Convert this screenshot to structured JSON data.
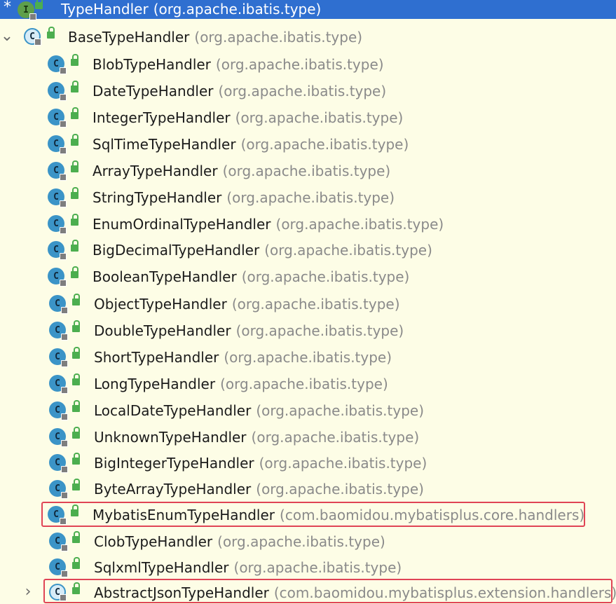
{
  "root": {
    "name": "TypeHandler",
    "package": "(org.apache.ibatis.type)",
    "star": "*",
    "icon_letter": "I"
  },
  "base": {
    "name": "BaseTypeHandler",
    "package": "(org.apache.ibatis.type)",
    "icon_letter": "C"
  },
  "items": [
    {
      "name": "BlobTypeHandler",
      "package": "(org.apache.ibatis.type)"
    },
    {
      "name": "DateTypeHandler",
      "package": "(org.apache.ibatis.type)"
    },
    {
      "name": "IntegerTypeHandler",
      "package": "(org.apache.ibatis.type)"
    },
    {
      "name": "SqlTimeTypeHandler",
      "package": "(org.apache.ibatis.type)"
    },
    {
      "name": "ArrayTypeHandler",
      "package": "(org.apache.ibatis.type)"
    },
    {
      "name": "StringTypeHandler",
      "package": "(org.apache.ibatis.type)"
    },
    {
      "name": "EnumOrdinalTypeHandler",
      "package": "(org.apache.ibatis.type)"
    },
    {
      "name": "BigDecimalTypeHandler",
      "package": "(org.apache.ibatis.type)"
    },
    {
      "name": "BooleanTypeHandler",
      "package": "(org.apache.ibatis.type)"
    },
    {
      "name": "ObjectTypeHandler",
      "package": "(org.apache.ibatis.type)"
    },
    {
      "name": "DoubleTypeHandler",
      "package": "(org.apache.ibatis.type)"
    },
    {
      "name": "ShortTypeHandler",
      "package": "(org.apache.ibatis.type)"
    },
    {
      "name": "LongTypeHandler",
      "package": "(org.apache.ibatis.type)"
    },
    {
      "name": "LocalDateTypeHandler",
      "package": "(org.apache.ibatis.type)"
    },
    {
      "name": "UnknownTypeHandler",
      "package": "(org.apache.ibatis.type)"
    },
    {
      "name": "BigIntegerTypeHandler",
      "package": "(org.apache.ibatis.type)"
    },
    {
      "name": "ByteArrayTypeHandler",
      "package": "(org.apache.ibatis.type)"
    },
    {
      "name": "MybatisEnumTypeHandler",
      "package": "(com.baomidou.mybatisplus.core.handlers)",
      "highlighted": true
    },
    {
      "name": "ClobTypeHandler",
      "package": "(org.apache.ibatis.type)"
    },
    {
      "name": "SqlxmlTypeHandler",
      "package": "(org.apache.ibatis.type)"
    },
    {
      "name": "AbstractJsonTypeHandler",
      "package": "(com.baomidou.mybatisplus.extension.handlers)",
      "highlighted": true,
      "collapsed": true
    }
  ],
  "icon_letter_class": "C",
  "colors": {
    "selection": "#2f6fd0",
    "background": "#fdfde6",
    "highlight_border": "#e04455",
    "package_text": "#8a8a8a",
    "class_icon": "#3b94c7",
    "interface_icon": "#5e9f4b",
    "lock_icon": "#4cae4f"
  },
  "icons": {
    "expand": "chevron-down-icon",
    "collapse": "chevron-right-icon",
    "class": "class-icon",
    "abstract_class": "abstract-class-icon",
    "interface": "interface-icon",
    "public_access": "lock-icon"
  }
}
